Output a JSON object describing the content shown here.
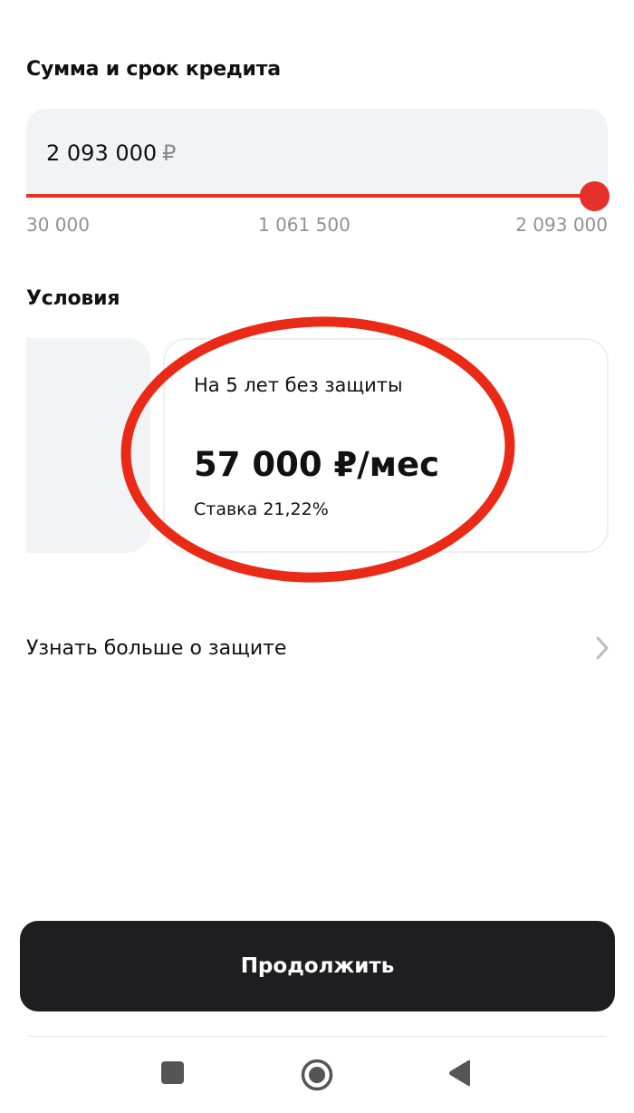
{
  "loan": {
    "title": "Сумма и срок кредита",
    "amount_value": "2 093 000",
    "currency": "₽",
    "slider_min": "30 000",
    "slider_mid": "1 061 500",
    "slider_max": "2 093 000",
    "slider_fraction": 1.0
  },
  "conditions": {
    "title": "Условия",
    "card": {
      "term": "На 5 лет без защиты",
      "payment": "57 000 ₽/мес",
      "rate": "Ставка 21,22%"
    }
  },
  "more_link": {
    "label": "Узнать больше о защите",
    "icon": "chevron-right-icon"
  },
  "continue_label": "Продолжить",
  "navbar": {
    "icons": [
      "recents-square-icon",
      "home-circle-icon",
      "back-triangle-icon"
    ]
  },
  "colors": {
    "accent": "#e8302a",
    "annotation": "#ea2a17",
    "button_bg": "#1e1e20",
    "field_bg": "#f2f3f5",
    "muted_text": "#8f9196"
  }
}
